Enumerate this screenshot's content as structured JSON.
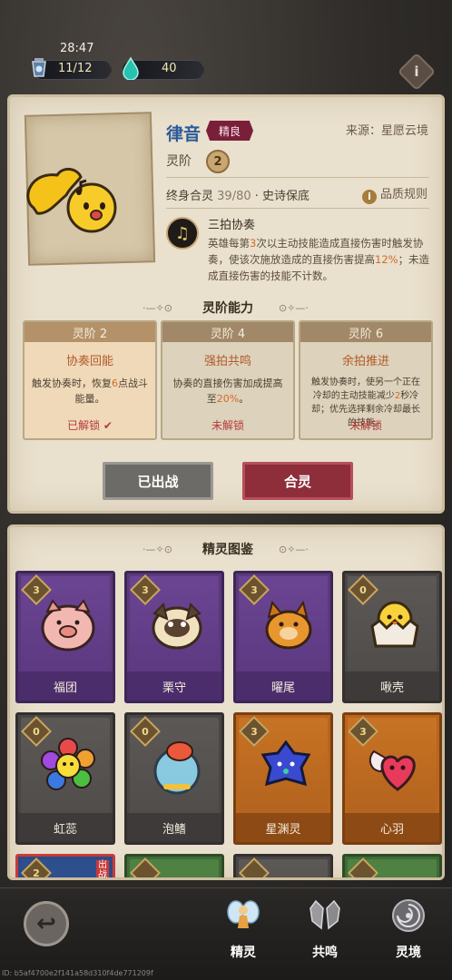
{
  "status": {
    "time": "28:47",
    "stamina": "11/12",
    "gems": "40"
  },
  "detail": {
    "name": "律音",
    "rarity": "精良",
    "source": "来源：星愿云境",
    "tier_label": "灵阶",
    "tier": "2",
    "lifetime_label": "终身合灵",
    "lifetime_value": "39/80",
    "lifetime_suffix": "· 史诗保底",
    "rules": "品质规则",
    "skill_name": "三拍协奏",
    "skill_desc_1": "英雄每第",
    "skill_desc_num1": "3",
    "skill_desc_2": "次以主动技能造成直接伤害时触发协奏，使该次施放造成的直接伤害提高",
    "skill_desc_num2": "12%",
    "skill_desc_3": "；未造成直接伤害的技能不计数。"
  },
  "abilities": {
    "title": "灵阶能力",
    "cards": [
      {
        "head": "灵阶 2",
        "title": "协奏回能",
        "text_a": "触发协奏时，恢复",
        "num": "6",
        "text_b": "点战斗能量。",
        "status": "已解锁 ✔"
      },
      {
        "head": "灵阶 4",
        "title": "强拍共鸣",
        "text_a": "协奏的直接伤害加成提高至",
        "num": "20%",
        "text_b": "。",
        "status": "未解锁"
      },
      {
        "head": "灵阶 6",
        "title": "余拍推进",
        "text_a": "触发协奏时，使另一个正在冷却的主动技能减少",
        "num": "2",
        "text_b": "秒冷却；优先选择剩余冷却最长的技能。",
        "status": "未解锁"
      }
    ]
  },
  "actions": {
    "deployed": "已出战",
    "merge": "合灵"
  },
  "codex": {
    "title": "精灵图鉴",
    "pets": [
      {
        "name": "福团",
        "level": "3",
        "color": "purple",
        "icon": "pig-icon"
      },
      {
        "name": "栗守",
        "level": "3",
        "color": "purple",
        "icon": "pug-icon"
      },
      {
        "name": "曜尾",
        "level": "3",
        "color": "purple",
        "icon": "fox-dog-icon"
      },
      {
        "name": "啾壳",
        "level": "0",
        "color": "gray",
        "icon": "egg-chick-icon"
      },
      {
        "name": "虹蕊",
        "level": "0",
        "color": "gray",
        "icon": "rainbow-flower-icon"
      },
      {
        "name": "泡鳍",
        "level": "0",
        "color": "gray",
        "icon": "fishbowl-icon"
      },
      {
        "name": "星渊灵",
        "level": "3",
        "color": "orange",
        "icon": "star-blob-icon"
      },
      {
        "name": "心羽",
        "level": "3",
        "color": "orange",
        "icon": "winged-heart-icon"
      }
    ],
    "partial_row": [
      {
        "level": "2",
        "badge": "出战",
        "color": "blue"
      },
      {
        "level": "",
        "color": "green"
      },
      {
        "level": "",
        "color": "gray"
      },
      {
        "level": "",
        "color": "green"
      }
    ]
  },
  "nav": {
    "spirit": "精灵",
    "resonance": "共鸣",
    "realm": "灵境"
  },
  "debug_id": "ID: b5af4700e2f141a58d310f4de771209f"
}
